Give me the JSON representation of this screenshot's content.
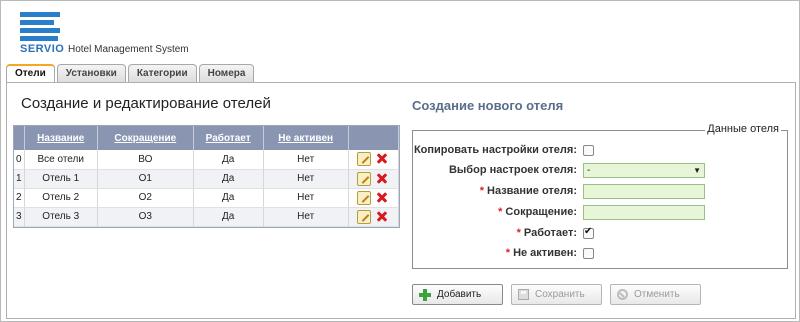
{
  "header": {
    "logo_text": "SERVIO",
    "subtitle": "Hotel Management System"
  },
  "tabs": [
    {
      "label": "Отели",
      "active": true
    },
    {
      "label": "Установки",
      "active": false
    },
    {
      "label": "Категории",
      "active": false
    },
    {
      "label": "Номера",
      "active": false
    }
  ],
  "left": {
    "title": "Создание и редактирование отелей",
    "table": {
      "columns": [
        "Название",
        "Сокращение",
        "Работает",
        "Не активен"
      ],
      "rows": [
        {
          "idx": "0",
          "name": "Все отели",
          "short": "ВО",
          "works": "Да",
          "inactive": "Нет"
        },
        {
          "idx": "1",
          "name": "Отель 1",
          "short": "О1",
          "works": "Да",
          "inactive": "Нет"
        },
        {
          "idx": "2",
          "name": "Отель 2",
          "short": "О2",
          "works": "Да",
          "inactive": "Нет"
        },
        {
          "idx": "3",
          "name": "Отель 3",
          "short": "О3",
          "works": "Да",
          "inactive": "Нет"
        }
      ]
    }
  },
  "right": {
    "title": "Создание нового отеля",
    "fieldset_legend": "Данные отеля",
    "fields": {
      "copy_settings_label": "Копировать настройки отеля:",
      "select_settings_label": "Выбор настроек отеля:",
      "select_settings_value": "-",
      "hotel_name_label": "Название отеля:",
      "hotel_name_value": "",
      "short_label": "Сокращение:",
      "short_value": "",
      "works_label": "Работает:",
      "works_checked": true,
      "inactive_label": "Не активен:",
      "inactive_checked": false,
      "copy_checked": false,
      "required_mark": "*"
    },
    "buttons": {
      "add": "Добавить",
      "save": "Сохранить",
      "cancel": "Отменить"
    }
  },
  "colors": {
    "brand": "#2a7fcb",
    "tab_active_accent": "#f5a623",
    "table_header": "#8a95b2",
    "input_bg": "#e6f6d6"
  }
}
